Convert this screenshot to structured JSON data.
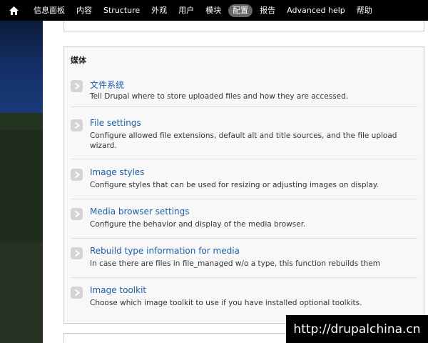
{
  "toolbar": {
    "home_icon": "home-icon",
    "items": [
      {
        "label": "信息面板",
        "active": false
      },
      {
        "label": "内容",
        "active": false
      },
      {
        "label": "Structure",
        "active": false
      },
      {
        "label": "外观",
        "active": false
      },
      {
        "label": "用户",
        "active": false
      },
      {
        "label": "模块",
        "active": false
      },
      {
        "label": "配置",
        "active": true
      },
      {
        "label": "报告",
        "active": false
      },
      {
        "label": "Advanced help",
        "active": false
      },
      {
        "label": "帮助",
        "active": false
      }
    ]
  },
  "panel": {
    "title": "媒体",
    "items": [
      {
        "title": "文件系统",
        "description": "Tell Drupal where to store uploaded files and how they are accessed."
      },
      {
        "title": "File settings",
        "description": "Configure allowed file extensions, default alt and title sources, and the file upload wizard."
      },
      {
        "title": "Image styles",
        "description": "Configure styles that can be used for resizing or adjusting images on display."
      },
      {
        "title": "Media browser settings",
        "description": "Configure the behavior and display of the media browser."
      },
      {
        "title": "Rebuild type information for media",
        "description": "In case there are files in file_managed w/o a type, this function rebuilds them"
      },
      {
        "title": "Image toolkit",
        "description": "Choose which image toolkit to use if you have installed optional toolkits."
      }
    ]
  },
  "watermark": "http://drupalchina.cn",
  "colors": {
    "toolbar_bg": "#000000",
    "active_pill": "#666666",
    "link": "#1d5fa8",
    "panel_bg": "#f8f8f8"
  }
}
